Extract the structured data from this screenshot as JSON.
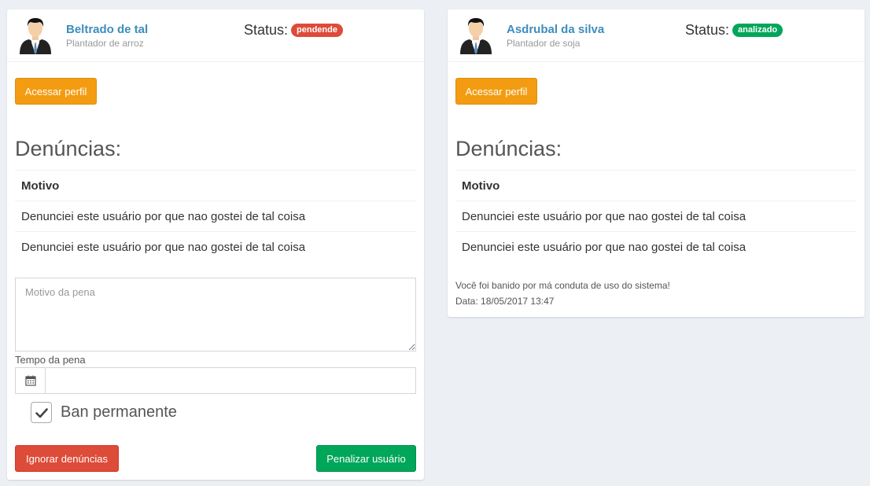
{
  "cards": [
    {
      "user_name": "Beltrado de tal",
      "user_desc": "Plantador de arroz",
      "status_label": "Status:",
      "status_value": "pendende",
      "status_color": "#dd4b39",
      "profile_button": "Acessar perfil",
      "section_title": "Denúncias:",
      "table_header": "Motivo",
      "rows": [
        "Denunciei este usuário por que nao gostei de tal coisa",
        "Denunciei este usuário por que nao gostei de tal coisa"
      ],
      "penalty_reason_placeholder": "Motivo da pena",
      "penalty_time_label": "Tempo da pena",
      "penalty_time_value": "",
      "permanent_ban_label": "Ban permanente",
      "permanent_ban_checked": true,
      "ignore_button": "Ignorar denúncias",
      "penalize_button": "Penalizar usuário"
    },
    {
      "user_name": "Asdrubal da silva",
      "user_desc": "Plantador de soja",
      "status_label": "Status:",
      "status_value": "analizado",
      "status_color": "#00a65a",
      "profile_button": "Acessar perfil",
      "section_title": "Denúncias:",
      "table_header": "Motivo",
      "rows": [
        "Denunciei este usuário por que nao gostei de tal coisa",
        "Denunciei este usuário por que nao gostei de tal coisa"
      ],
      "ban_message": "Você foi banido por má conduta de uso do sistema!",
      "ban_date": "Data: 18/05/2017 13:47"
    }
  ],
  "icons": {
    "avatar": "businessman-avatar-icon",
    "calendar": "calendar-icon",
    "check": "check-icon"
  }
}
